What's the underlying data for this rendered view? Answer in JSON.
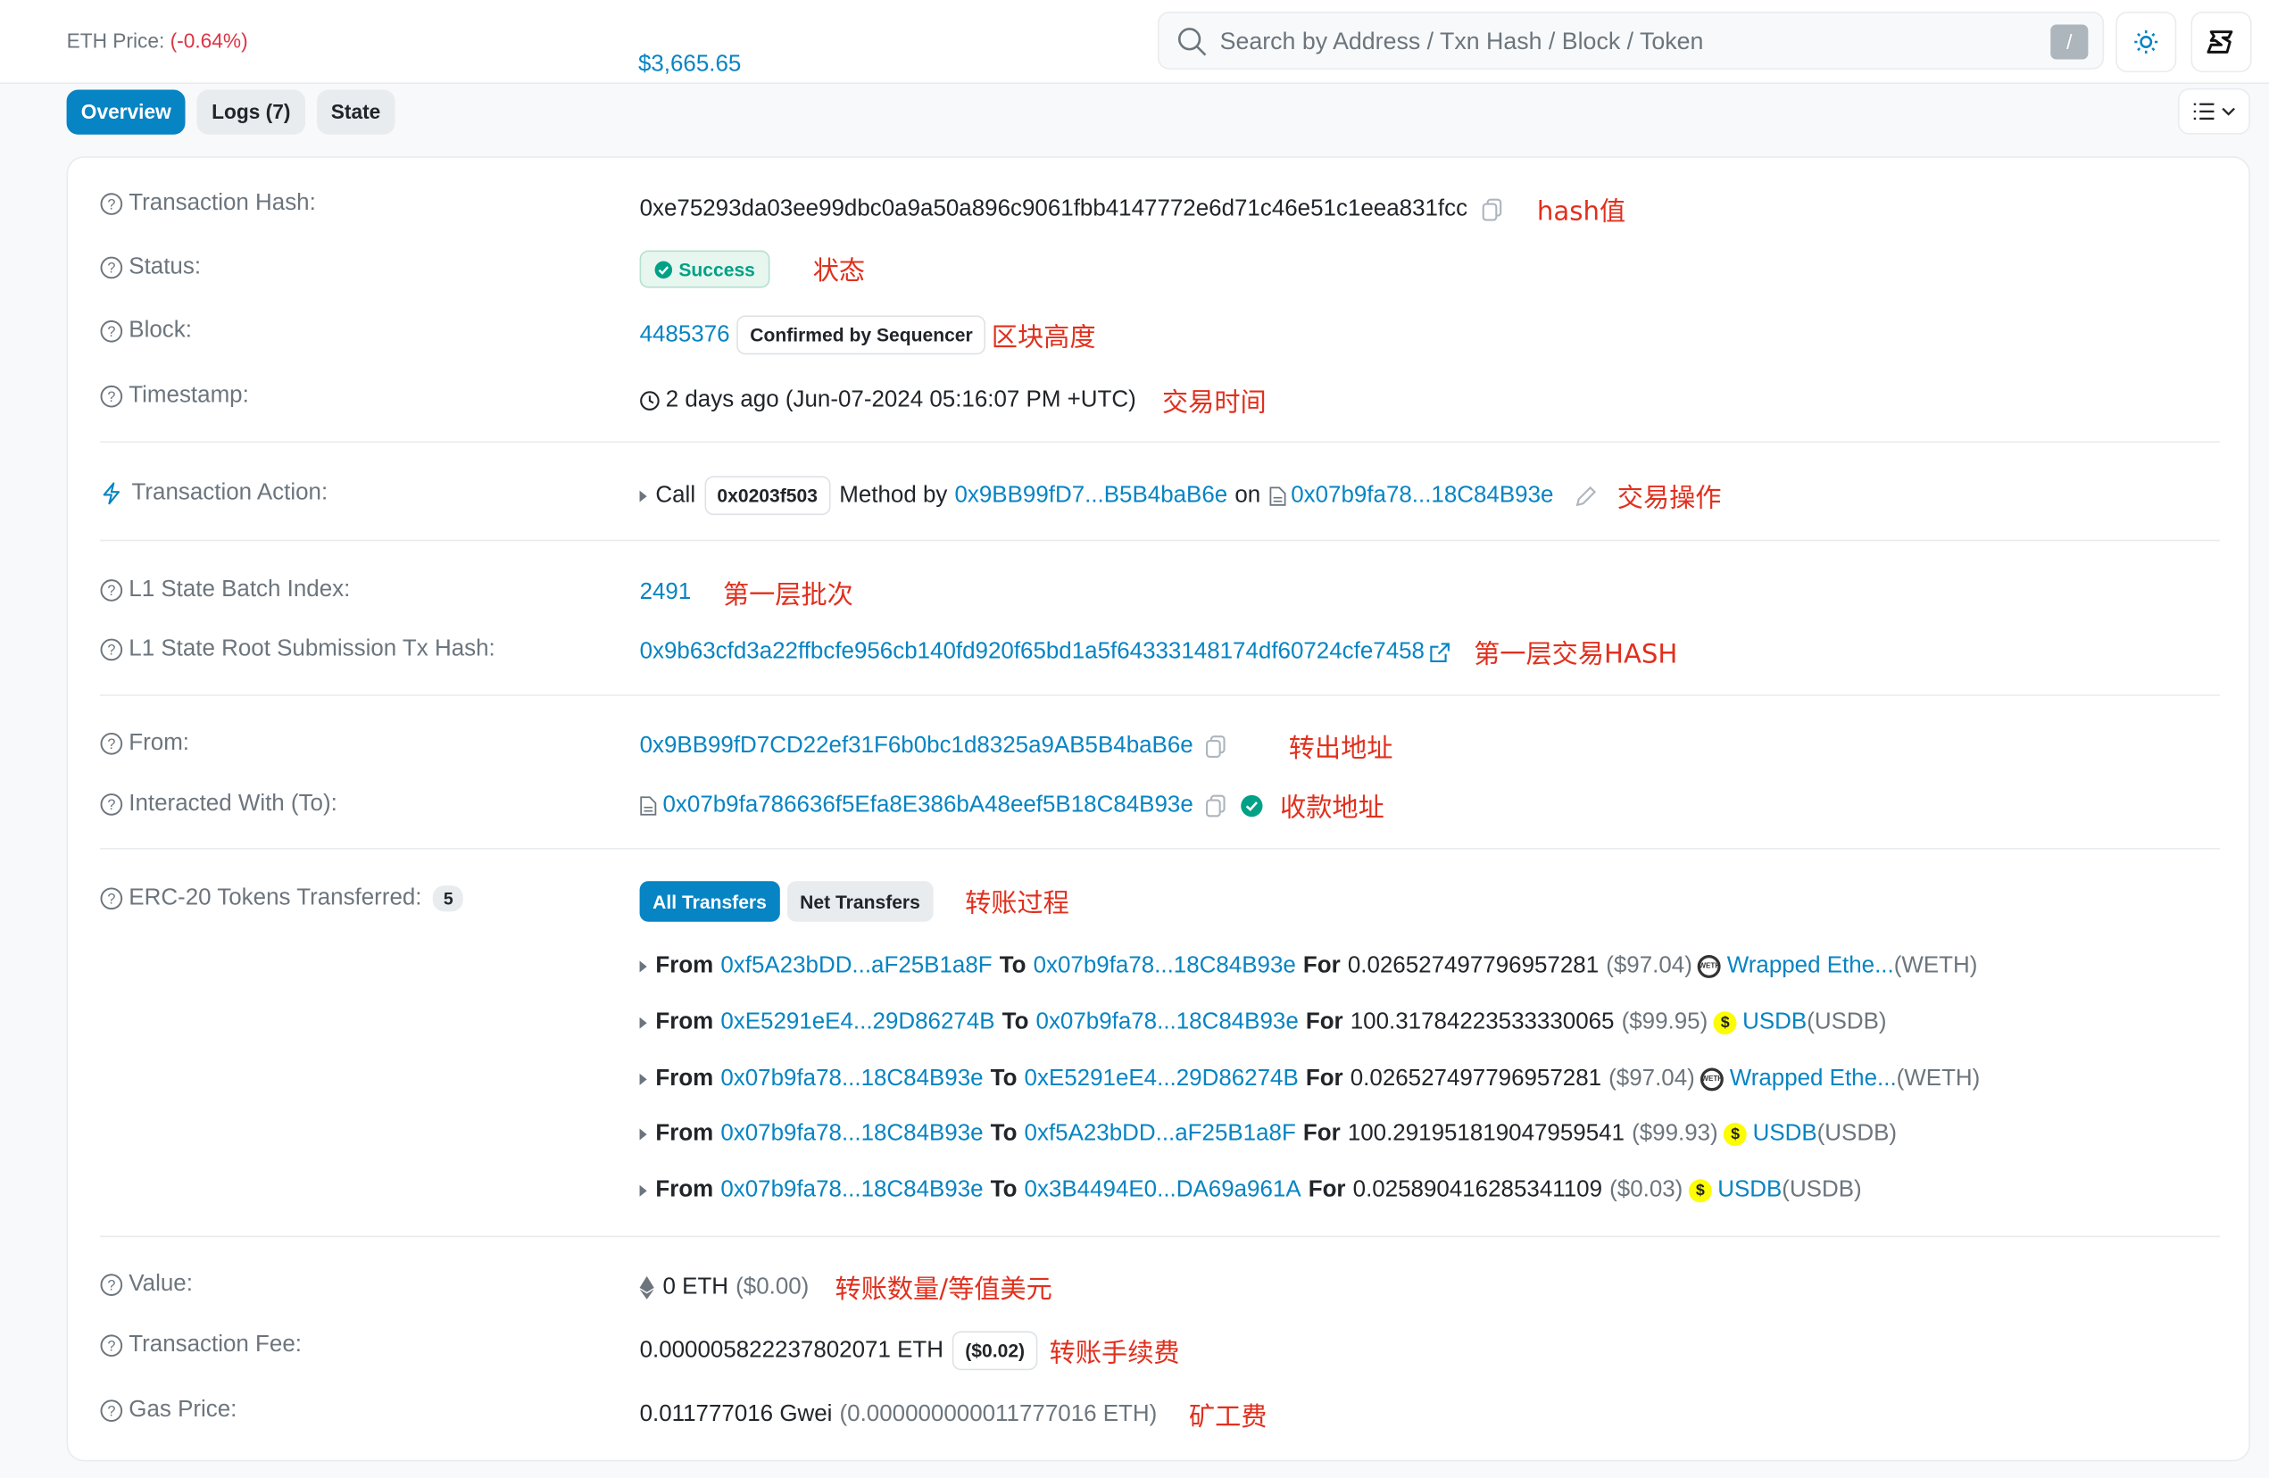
{
  "topbar": {
    "eth_price_label": "ETH Price:",
    "eth_price_value": "$3,665.65",
    "eth_price_change": "(-0.64%)",
    "search_placeholder": "Search by Address / Txn Hash / Block / Token",
    "search_shortcut": "/"
  },
  "tabs": [
    {
      "label": "Overview",
      "active": true
    },
    {
      "label": "Logs (7)",
      "active": false
    },
    {
      "label": "State",
      "active": false
    }
  ],
  "details": {
    "tx_hash": {
      "label": "Transaction Hash:",
      "value": "0xe75293da03ee99dbc0a9a50a896c9061fbb4147772e6d71c46e51c1eea831fcc",
      "note": "hash值"
    },
    "status": {
      "label": "Status:",
      "value": "Success",
      "note": "状态"
    },
    "block": {
      "label": "Block:",
      "value": "4485376",
      "badge": "Confirmed by Sequencer",
      "note": "区块高度"
    },
    "timestamp": {
      "label": "Timestamp:",
      "value": "2 days ago (Jun-07-2024 05:16:07 PM +UTC)",
      "note": "交易时间"
    },
    "action": {
      "label": "Transaction Action:",
      "call": "Call",
      "method_id": "0x0203f503",
      "method_by": "Method by",
      "by_address": "0x9BB99fD7...B5B4baB6e",
      "on": "on",
      "contract": "0x07b9fa78...18C84B93e",
      "note": "交易操作"
    },
    "l1_batch": {
      "label": "L1 State Batch Index:",
      "value": "2491",
      "note": "第一层批次"
    },
    "l1_root": {
      "label": "L1 State Root Submission Tx Hash:",
      "value": "0x9b63cfd3a22ffbcfe956cb140fd920f65bd1a5f64333148174df60724cfe7458",
      "note": "第一层交易HASH"
    },
    "from": {
      "label": "From:",
      "value": "0x9BB99fD7CD22ef31F6b0bc1d8325a9AB5B4baB6e",
      "note": "转出地址"
    },
    "to": {
      "label": "Interacted With (To):",
      "value": "0x07b9fa786636f5Efa8E386bA48eef5B18C84B93e",
      "note": "收款地址"
    },
    "erc20": {
      "label": "ERC-20 Tokens Transferred:",
      "count": "5",
      "tab_all": "All Transfers",
      "tab_net": "Net Transfers",
      "note": "转账过程",
      "transfers": [
        {
          "from": "0xf5A23bDD...aF25B1a8F",
          "to": "0x07b9fa78...18C84B93e",
          "amount": "0.026527497796957281",
          "usd": "($97.04)",
          "token": "Wrapped Ethe...",
          "symbol": "(WETH)",
          "icon": "weth"
        },
        {
          "from": "0xE5291eE4...29D86274B",
          "to": "0x07b9fa78...18C84B93e",
          "amount": "100.31784223533330065",
          "usd": "($99.95)",
          "token": "USDB",
          "symbol": "(USDB)",
          "icon": "usdb"
        },
        {
          "from": "0x07b9fa78...18C84B93e",
          "to": "0xE5291eE4...29D86274B",
          "amount": "0.026527497796957281",
          "usd": "($97.04)",
          "token": "Wrapped Ethe...",
          "symbol": "(WETH)",
          "icon": "weth"
        },
        {
          "from": "0x07b9fa78...18C84B93e",
          "to": "0xf5A23bDD...aF25B1a8F",
          "amount": "100.291951819047959541",
          "usd": "($99.93)",
          "token": "USDB",
          "symbol": "(USDB)",
          "icon": "usdb"
        },
        {
          "from": "0x07b9fa78...18C84B93e",
          "to": "0x3B4494E0...DA69a961A",
          "amount": "0.025890416285341109",
          "usd": "($0.03)",
          "token": "USDB",
          "symbol": "(USDB)",
          "icon": "usdb"
        }
      ],
      "from_word": "From",
      "to_word": "To",
      "for_word": "For"
    },
    "value": {
      "label": "Value:",
      "value": "0 ETH",
      "usd": "($0.00)",
      "note": "转账数量/等值美元"
    },
    "fee": {
      "label": "Transaction Fee:",
      "value": "0.000005822237802071 ETH",
      "usd": "($0.02)",
      "note": "转账手续费"
    },
    "gas": {
      "label": "Gas Price:",
      "value": "0.011777016 Gwei",
      "eth": "(0.000000000011777016 ETH)",
      "note": "矿工费"
    }
  },
  "colors": {
    "accent": "#0784c3",
    "note": "#e0301e",
    "success": "#00a186"
  }
}
